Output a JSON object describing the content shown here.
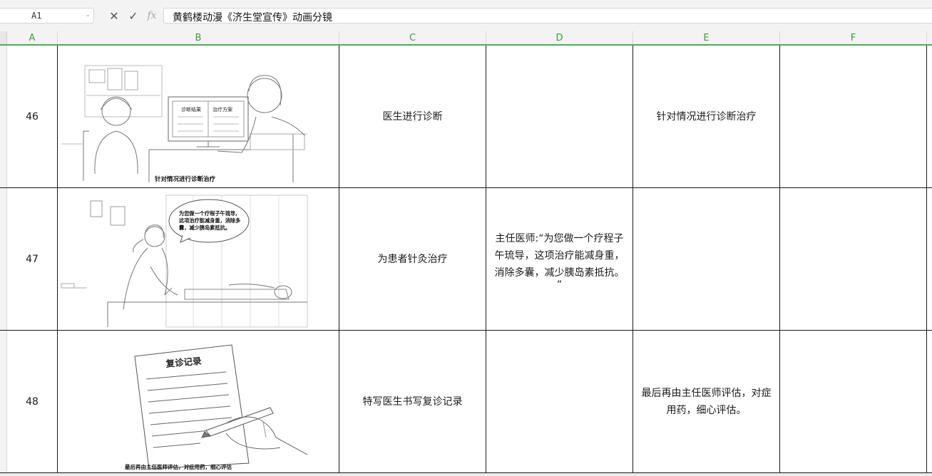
{
  "formula_bar": {
    "name_box": "A1",
    "cancel_icon": "close-icon",
    "confirm_icon": "check-icon",
    "fx_label": "fx",
    "formula": "黄鹤楼动漫《济生堂宣传》动画分镜"
  },
  "columns": [
    "A",
    "B",
    "C",
    "D",
    "E",
    "F"
  ],
  "rows": [
    {
      "num": "46",
      "image": {
        "caption": "针对情况进行诊断治疗",
        "screen_left": "诊断结果",
        "screen_right": "治疗方案"
      },
      "c": "医生进行诊断",
      "d": "",
      "e": "针对情况进行诊断治疗",
      "f": ""
    },
    {
      "num": "47",
      "image": {
        "bubble_lines": [
          "为您做一个疗程子午琉导,",
          "这项治疗能减身重，消除多",
          "囊，减少胰岛素抵抗。"
        ]
      },
      "c": "为患者针灸治疗",
      "d_lines": [
        "主任医师:“为您做一个疗程子",
        "午琉导，这项治疗能减身重，",
        "消除多囊，减少胰岛素抵抗。",
        "”"
      ],
      "e": "",
      "f": ""
    },
    {
      "num": "48",
      "image": {
        "title": "复诊记录",
        "caption": "最后再由主任医师评估，对症用药，细心评估"
      },
      "c": "特写医生书写复诊记录",
      "d": "",
      "e_lines": [
        "最后再由主任医师评估，对症",
        "用药，细心评估。"
      ],
      "f": ""
    }
  ]
}
